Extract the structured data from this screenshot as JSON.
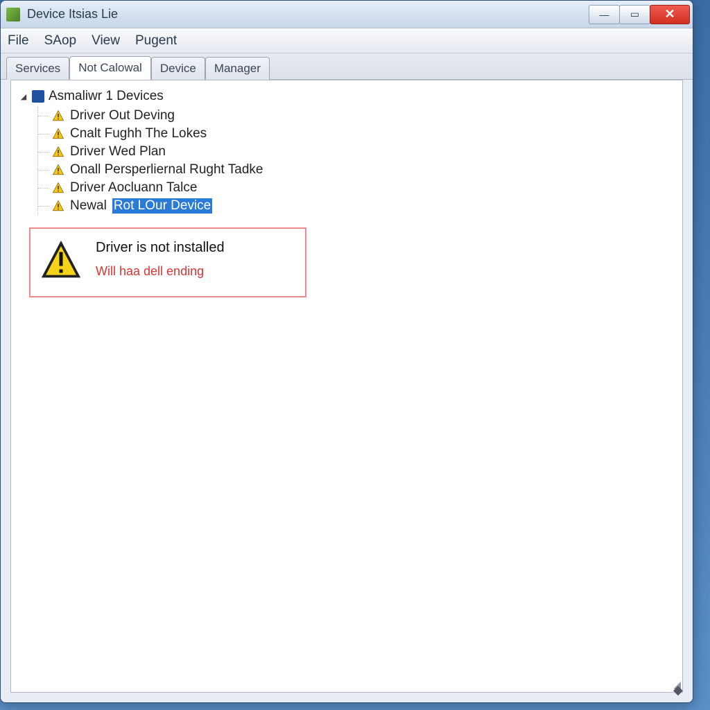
{
  "window": {
    "title": "Device Itsias Lie"
  },
  "menu": {
    "file": "File",
    "shop": "SAop",
    "view": "View",
    "pugent": "Pugent"
  },
  "tabs": {
    "services": "Services",
    "not_calowal": "Not Calowal",
    "device": "Device",
    "manager": "Manager"
  },
  "tree": {
    "root_label": "Asmaliwr 1 Devices",
    "items": [
      {
        "label": "Driver Out Deving"
      },
      {
        "label": "Cnalt Fughh The Lokes"
      },
      {
        "label": "Driver Wed Plan"
      },
      {
        "label": "Onall Persperliernal Rught Tadke"
      },
      {
        "label": "Driver Aocluann Talce"
      }
    ],
    "selected_item": {
      "prefix": "Newal",
      "highlight": "Rot LOur Device"
    }
  },
  "infobox": {
    "main": "Driver is not installed",
    "sub": "Will haa dell ending"
  }
}
